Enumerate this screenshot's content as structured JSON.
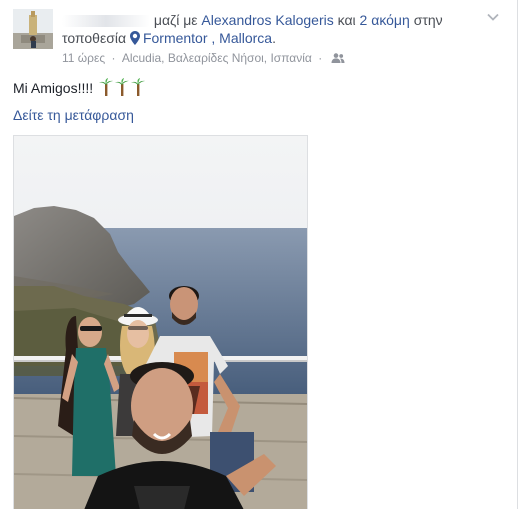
{
  "post": {
    "header": {
      "with_text": "μαζί με",
      "tagged_person": "Alexandros Kalogeris",
      "and_text": "και",
      "others_link": "2 ακόμη",
      "location_prefix_line1": "στην",
      "location_prefix_line2": "τοποθεσία",
      "place": "Formentor , Mallorca",
      "place_suffix": "."
    },
    "meta": {
      "time": "11 ώρες",
      "location": "Alcudia, Βαλεαρίδες Νήσοι, Ισπανία",
      "separator": "·",
      "audience_icon": "friends-icon"
    },
    "message": "Mi Amigos!!!!",
    "message_emoji": "palm-trees",
    "translate_link": "Δείτε τη μετάφραση",
    "options_icon": "chevron-down-icon"
  },
  "colors": {
    "link": "#365899",
    "meta": "#90949c",
    "text": "#1d2129"
  }
}
